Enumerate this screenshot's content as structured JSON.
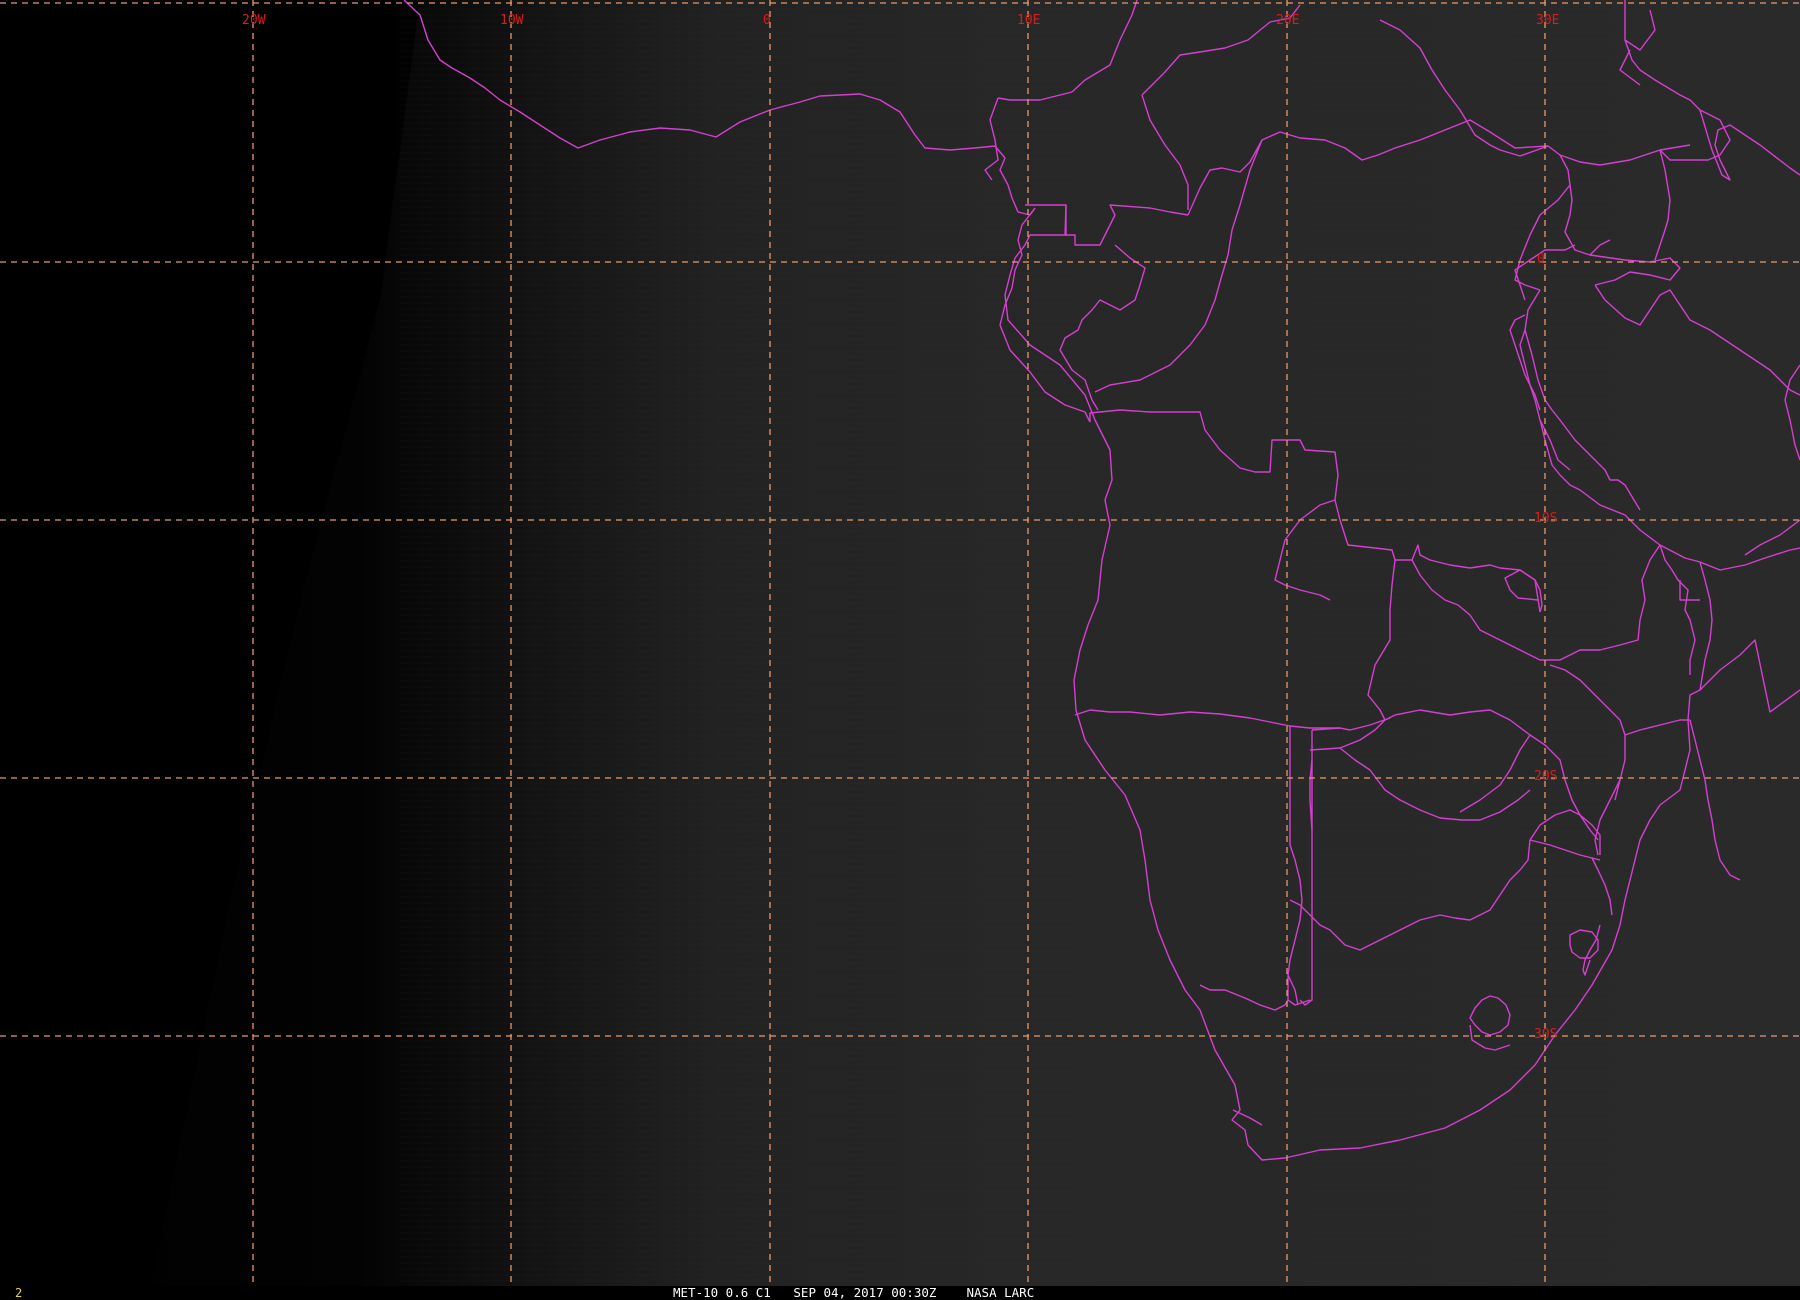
{
  "map": {
    "projection": "satellite image (map)",
    "grid": {
      "longitude_labels": [
        "20W",
        "10W",
        "0",
        "10E",
        "20E",
        "30E"
      ],
      "latitude_labels": [
        "0",
        "10S",
        "20S",
        "30S"
      ]
    },
    "colors": {
      "background": "#000000",
      "land_tone": "#2b2b2b",
      "gridlines": "#e89a6a",
      "grid_labels": "#d21f1f",
      "borders": "#d53fd0",
      "footer_bar": "#000000",
      "frame_number": "#e8d33a"
    }
  },
  "footer": {
    "frame_number": "2",
    "caption": "MET-10 0.6 C1   SEP 04, 2017 00:30Z    NASA LARC"
  }
}
